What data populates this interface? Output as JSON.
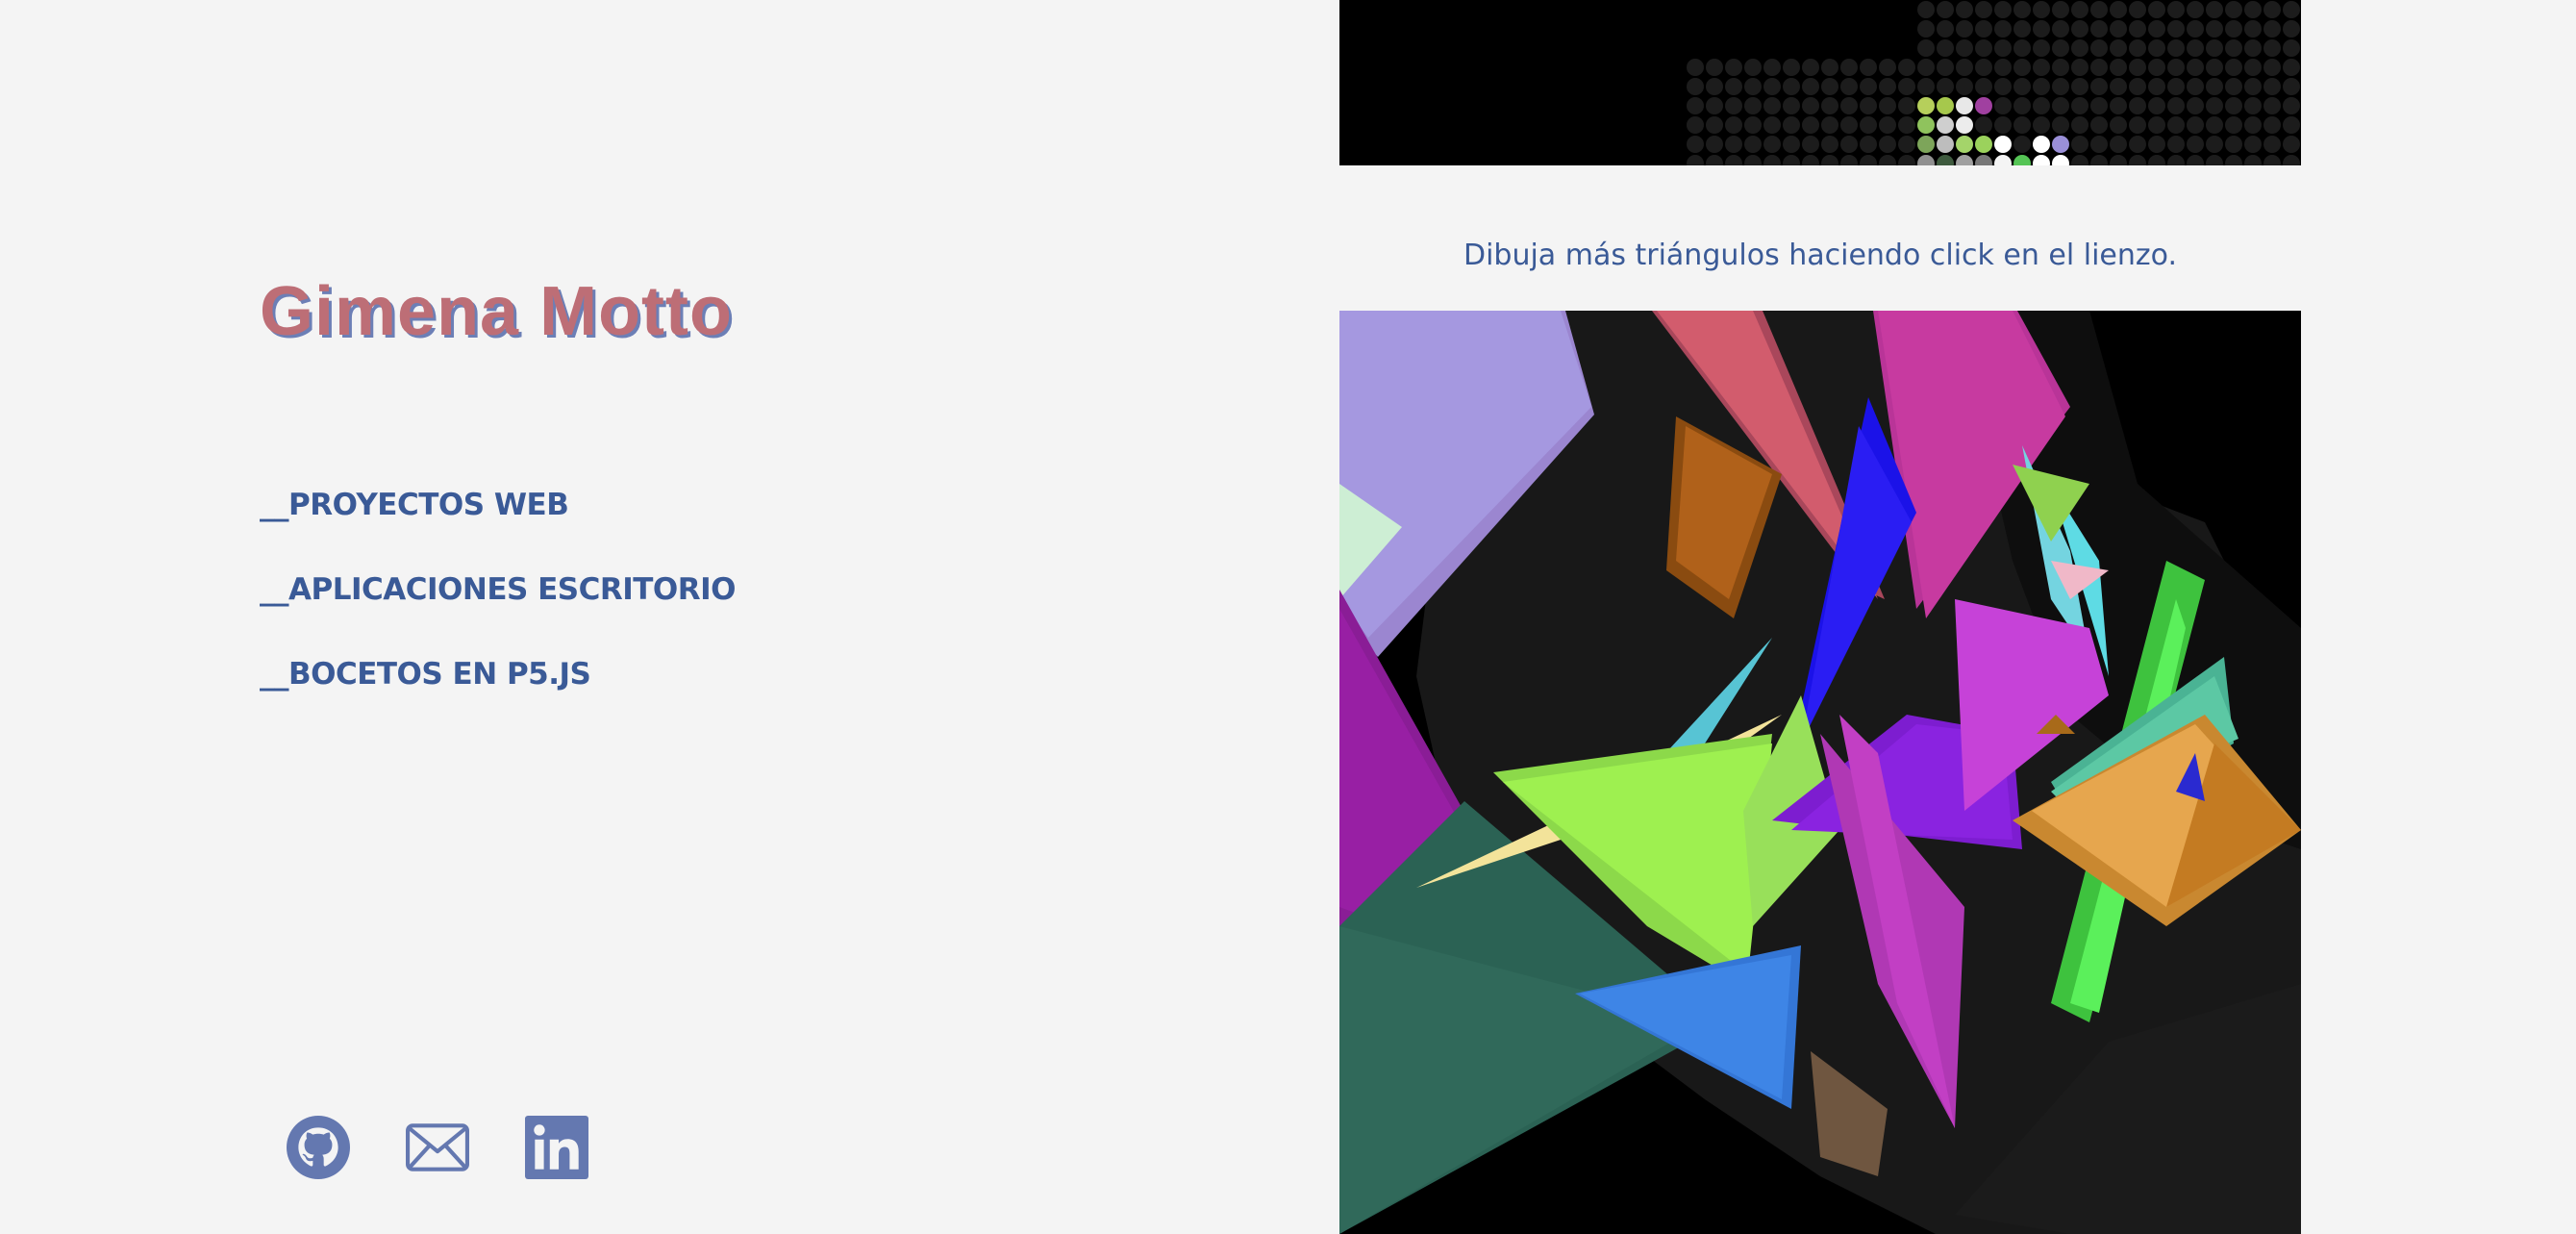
{
  "site": {
    "author_name": "Gimena Motto"
  },
  "nav": {
    "items": [
      {
        "label": "__PROYECTOS WEB"
      },
      {
        "label": "__APLICACIONES ESCRITORIO"
      },
      {
        "label": "__BOCETOS EN P5.JS"
      }
    ]
  },
  "socials": [
    {
      "icon": "github-icon"
    },
    {
      "icon": "mail-icon"
    },
    {
      "icon": "linkedin-icon"
    }
  ],
  "sketch": {
    "caption": "Dibuja más triángulos haciendo click en el lienzo."
  },
  "colors": {
    "background": "#f4f4f4",
    "title": "#bd6e76",
    "title_shadow": "#6c7fb6",
    "link": "#3a5a97",
    "icon": "#6478b0"
  }
}
